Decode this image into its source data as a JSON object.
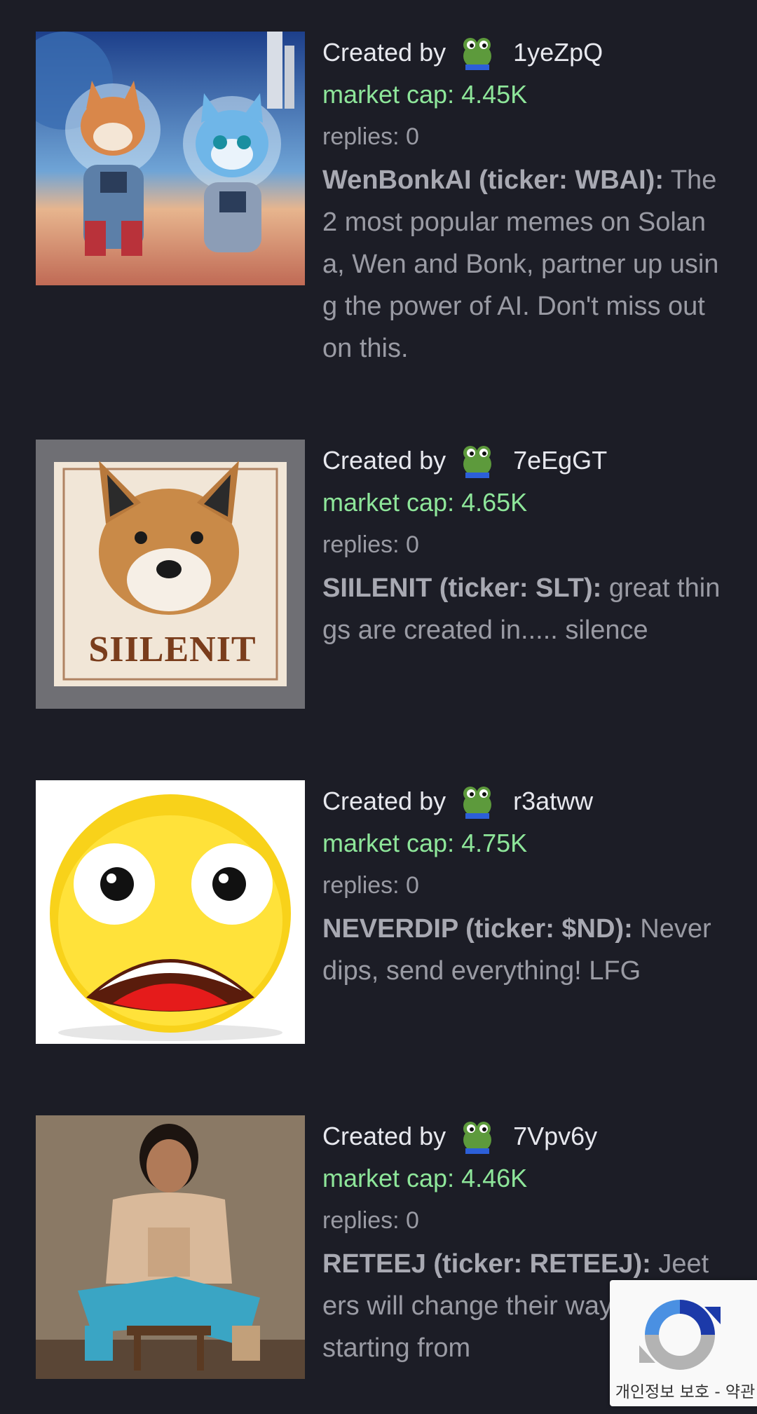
{
  "tokens": [
    {
      "created_by_label": "Created by",
      "creator": "1yeZpQ",
      "market_cap": "market cap: 4.45K",
      "replies": "replies: 0",
      "name": "WenBonkAI (ticker: WBAI):",
      "description": "The 2 most popular memes on Solana, Wen and Bonk, partner up using the power of AI. Don't miss out on this."
    },
    {
      "created_by_label": "Created by",
      "creator": "7eEgGT",
      "market_cap": "market cap: 4.65K",
      "replies": "replies: 0",
      "name": "SIILENIT (ticker: SLT):",
      "description": "great things are created in..... silence",
      "image_text": "SIILENIT"
    },
    {
      "created_by_label": "Created by",
      "creator": "r3atww",
      "market_cap": "market cap: 4.75K",
      "replies": "replies: 0",
      "name": "NEVERDIP (ticker: $ND):",
      "description": "Never dips, send everything! LFG"
    },
    {
      "created_by_label": "Created by",
      "creator": "7Vpv6y",
      "market_cap": "market cap: 4.46K",
      "replies": "replies: 0",
      "name": "RETEEJ (ticker: RETEEJ):",
      "description": "Jeeters will change their way of living starting from"
    }
  ],
  "recaptcha": {
    "terms": "개인정보 보호 - 약관"
  },
  "colors": {
    "background": "#1c1d26",
    "market_cap": "#8ee69a",
    "text": "#9a9ba4",
    "creator": "#e7e8ee"
  }
}
